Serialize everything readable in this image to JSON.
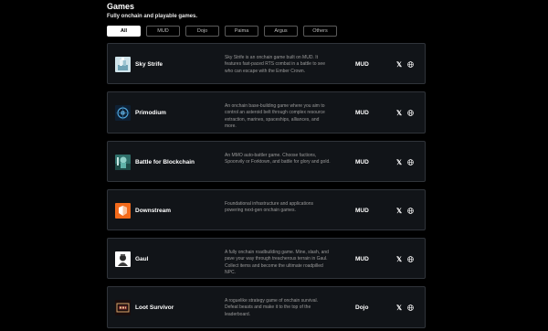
{
  "header": {
    "title": "Games",
    "subtitle": "Fully onchain and playable games."
  },
  "filters": [
    {
      "label": "All",
      "active": true
    },
    {
      "label": "MUD",
      "active": false
    },
    {
      "label": "Dojo",
      "active": false
    },
    {
      "label": "Paima",
      "active": false
    },
    {
      "label": "Argus",
      "active": false
    },
    {
      "label": "Others",
      "active": false
    }
  ],
  "games": [
    {
      "name": "Sky Strife",
      "description": "Sky Strife is an onchain game built on MUD. It features fast-paced RTS combat in a battle to see who can escape with the Ember Crown.",
      "engine": "MUD",
      "icon": "sky-strife-logo",
      "x_icon": "𝕏"
    },
    {
      "name": "Primodium",
      "description": "An onchain base-building game where you aim to control an asteroid belt through complex resource extraction, marines, spaceships, alliances, and more.",
      "engine": "MUD",
      "icon": "primodium-logo",
      "x_icon": "𝕏"
    },
    {
      "name": "Battle for Blockchain",
      "description": "An MMO auto-battler game. Choose factions, Spoonvily or Forktown, and battle for glory and gold.",
      "engine": "MUD",
      "icon": "battle-for-blockchain-logo",
      "x_icon": "𝕏"
    },
    {
      "name": "Downstream",
      "description": "Foundational infrastructure and applications powering next-gen onchain games.",
      "engine": "MUD",
      "icon": "downstream-logo",
      "x_icon": "𝕏"
    },
    {
      "name": "Gaul",
      "description": "A fully onchain roadbuilding game. Mine, slash, and pave your way through treacherous terrain in Gaul. Collect items and become the ultimate roadpilled NPC.",
      "engine": "MUD",
      "icon": "gaul-logo",
      "x_icon": "𝕏"
    },
    {
      "name": "Loot Survivor",
      "description": "A roguelike strategy game of onchain survival. Defeat beasts and make it to the top of the leaderboard.",
      "engine": "Dojo",
      "icon": "loot-survivor-logo",
      "x_icon": "𝕏"
    }
  ]
}
